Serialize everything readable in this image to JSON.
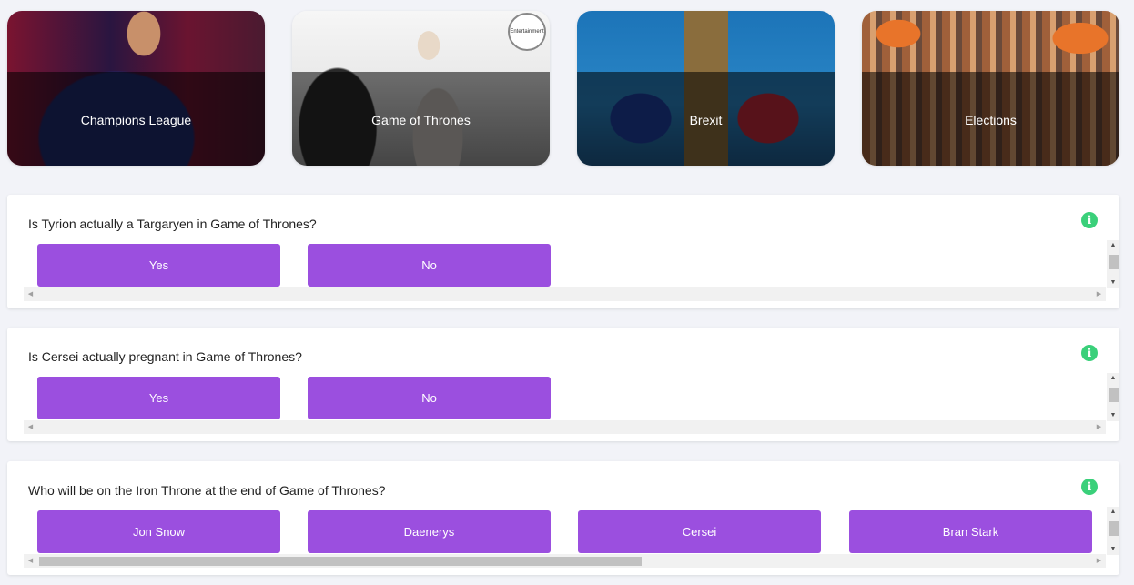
{
  "topics": [
    {
      "label": "Champions League"
    },
    {
      "label": "Game of Thrones",
      "badge": "Entertainment"
    },
    {
      "label": "Brexit"
    },
    {
      "label": "Elections"
    }
  ],
  "polls": [
    {
      "question": "Is Tyrion actually a Targaryen in Game of Thrones?",
      "info_icon": "i",
      "options": [
        "Yes",
        "No"
      ]
    },
    {
      "question": "Is Cersei actually pregnant in Game of Thrones?",
      "info_icon": "i",
      "options": [
        "Yes",
        "No"
      ]
    },
    {
      "question": "Who will be on the Iron Throne at the end of Game of Thrones?",
      "info_icon": "i",
      "options": [
        "Jon Snow",
        "Daenerys",
        "Cersei",
        "Bran Stark"
      ]
    }
  ],
  "scroll_glyphs": {
    "up": "▲",
    "down": "▼",
    "left": "◀",
    "right": "▶"
  },
  "colors": {
    "option_bg": "#9b4fdf",
    "info": "#3ad07a",
    "page_bg": "#f2f3f8"
  }
}
